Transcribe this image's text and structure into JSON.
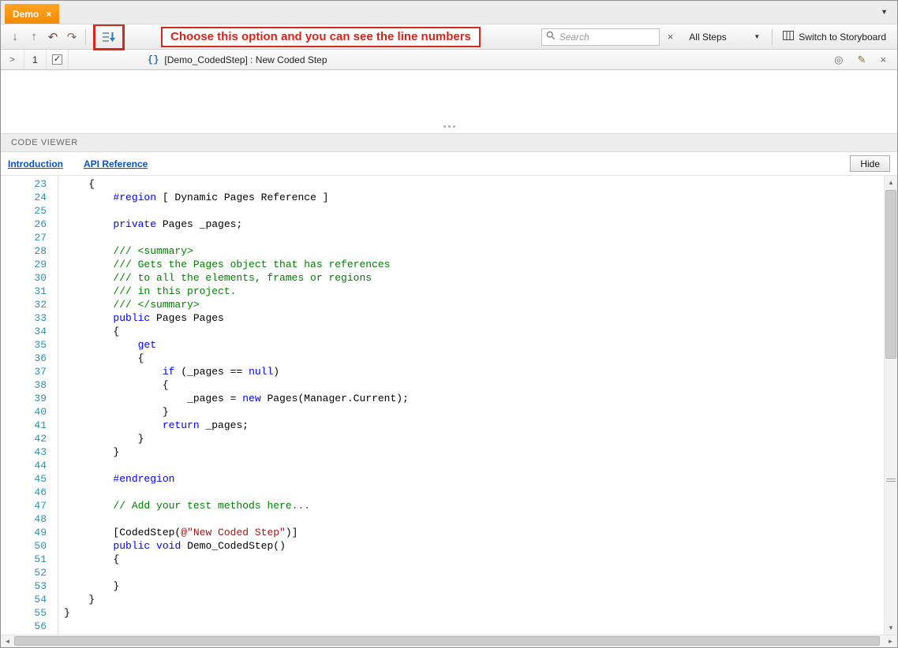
{
  "tab_strip": {
    "tab_title": "Demo",
    "close_glyph": "×",
    "overflow_glyph": "▼"
  },
  "toolbar": {
    "move_down_glyph": "↓",
    "move_up_glyph": "↑",
    "undo_glyph": "↶",
    "redo_glyph": "↷",
    "annotation": "Choose this option and you can see the line numbers",
    "search_placeholder": "Search",
    "clear_glyph": "×",
    "steps_filter_label": "All Steps",
    "dropdown_glyph": "▼",
    "storyboard_label": "Switch to Storyboard"
  },
  "step_row": {
    "expander_glyph": ">",
    "number": "1",
    "check_glyph": "✓",
    "step_icon_glyph": "{}",
    "label": "[Demo_CodedStep] : New Coded Step",
    "target_glyph": "◎",
    "edit_glyph": "✎",
    "close_glyph": "×"
  },
  "code_viewer": {
    "title": "CODE VIEWER",
    "links": [
      {
        "label": "Introduction"
      },
      {
        "label": "API Reference"
      }
    ],
    "hide_button": "Hide"
  },
  "scrollbars": {
    "up": "▲",
    "down": "▼",
    "left": "◄",
    "right": "►"
  },
  "syntax_colors": {
    "keyword": "#0000ff",
    "comment": "#008000",
    "string": "#a31515",
    "preprocessor": "#0000ff",
    "plain": "#000000",
    "line_number": "#2b91af"
  },
  "code": {
    "lines": [
      {
        "n": 23,
        "t": [
          [
            "p",
            "    {"
          ]
        ]
      },
      {
        "n": 24,
        "t": [
          [
            "p",
            "        "
          ],
          [
            "d",
            "#region"
          ],
          [
            "p",
            " [ Dynamic Pages Reference ]"
          ]
        ]
      },
      {
        "n": 25,
        "t": []
      },
      {
        "n": 26,
        "t": [
          [
            "p",
            "        "
          ],
          [
            "k",
            "private"
          ],
          [
            "p",
            " Pages _pages;"
          ]
        ]
      },
      {
        "n": 27,
        "t": []
      },
      {
        "n": 28,
        "t": [
          [
            "c",
            "        /// <summary>"
          ]
        ]
      },
      {
        "n": 29,
        "t": [
          [
            "c",
            "        /// Gets the Pages object that has references"
          ]
        ]
      },
      {
        "n": 30,
        "t": [
          [
            "c",
            "        /// to all the elements, frames or regions"
          ]
        ]
      },
      {
        "n": 31,
        "t": [
          [
            "c",
            "        /// in this project."
          ]
        ]
      },
      {
        "n": 32,
        "t": [
          [
            "c",
            "        /// </summary>"
          ]
        ]
      },
      {
        "n": 33,
        "t": [
          [
            "p",
            "        "
          ],
          [
            "k",
            "public"
          ],
          [
            "p",
            " Pages Pages"
          ]
        ]
      },
      {
        "n": 34,
        "t": [
          [
            "p",
            "        {"
          ]
        ]
      },
      {
        "n": 35,
        "t": [
          [
            "p",
            "            "
          ],
          [
            "k",
            "get"
          ]
        ]
      },
      {
        "n": 36,
        "t": [
          [
            "p",
            "            {"
          ]
        ]
      },
      {
        "n": 37,
        "t": [
          [
            "p",
            "                "
          ],
          [
            "k",
            "if"
          ],
          [
            "p",
            " (_pages == "
          ],
          [
            "k",
            "null"
          ],
          [
            "p",
            ")"
          ]
        ]
      },
      {
        "n": 38,
        "t": [
          [
            "p",
            "                {"
          ]
        ]
      },
      {
        "n": 39,
        "t": [
          [
            "p",
            "                    _pages = "
          ],
          [
            "k",
            "new"
          ],
          [
            "p",
            " Pages(Manager.Current);"
          ]
        ]
      },
      {
        "n": 40,
        "t": [
          [
            "p",
            "                }"
          ]
        ]
      },
      {
        "n": 41,
        "t": [
          [
            "p",
            "                "
          ],
          [
            "k",
            "return"
          ],
          [
            "p",
            " _pages;"
          ]
        ]
      },
      {
        "n": 42,
        "t": [
          [
            "p",
            "            }"
          ]
        ]
      },
      {
        "n": 43,
        "t": [
          [
            "p",
            "        }"
          ]
        ]
      },
      {
        "n": 44,
        "t": []
      },
      {
        "n": 45,
        "t": [
          [
            "p",
            "        "
          ],
          [
            "d",
            "#endregion"
          ]
        ]
      },
      {
        "n": 46,
        "t": []
      },
      {
        "n": 47,
        "t": [
          [
            "c",
            "        // Add your test methods here..."
          ]
        ]
      },
      {
        "n": 48,
        "t": []
      },
      {
        "n": 49,
        "t": [
          [
            "p",
            "        [CodedStep("
          ],
          [
            "s",
            "@\"New Coded Step\""
          ],
          [
            "p",
            ")]"
          ]
        ]
      },
      {
        "n": 50,
        "t": [
          [
            "p",
            "        "
          ],
          [
            "k",
            "public"
          ],
          [
            "p",
            " "
          ],
          [
            "k",
            "void"
          ],
          [
            "p",
            " Demo_CodedStep()"
          ]
        ]
      },
      {
        "n": 51,
        "t": [
          [
            "p",
            "        {"
          ]
        ]
      },
      {
        "n": 52,
        "t": []
      },
      {
        "n": 53,
        "t": [
          [
            "p",
            "        }"
          ]
        ]
      },
      {
        "n": 54,
        "t": [
          [
            "p",
            "    }"
          ]
        ]
      },
      {
        "n": 55,
        "t": [
          [
            "p",
            "}"
          ]
        ]
      },
      {
        "n": 56,
        "t": []
      }
    ]
  }
}
